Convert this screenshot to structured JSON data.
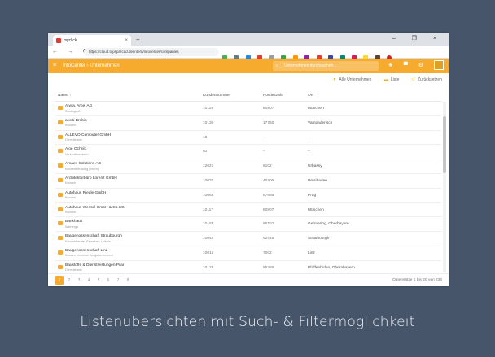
{
  "browser": {
    "tab_title": "myclick",
    "tab_close": "×",
    "new_tab": "+",
    "window_controls": "– ❐ ×",
    "nav": "← → C",
    "url": "https://cloud.topsparcad.de/intern/infocenter/companies"
  },
  "app": {
    "menu_icon": "≡",
    "breadcrumb": "InfoCenter › Unternehmen",
    "search_placeholder": "Unternehmen durchsuchen...",
    "accent_color": "#f6ab2e"
  },
  "actions": {
    "all": "Alle Unternehmen",
    "list": "Liste",
    "reset": "Zurücksetzen"
  },
  "table": {
    "headers": [
      "Name ↑",
      "Kundennummer",
      "Postleitzahl",
      "Ort"
    ],
    "rows": [
      {
        "name": "A.w.a. Arbel AG",
        "sub": "Stadtsgroß",
        "num": "10119",
        "zip": "80807",
        "city": "München"
      },
      {
        "name": "acotti Brebio",
        "sub": "Kunden",
        "num": "10130",
        "zip": "17750",
        "city": "Vampadensch"
      },
      {
        "name": "ALLEVO Computer GmbH",
        "sub": "Dienstleister",
        "num": "18",
        "zip": "–",
        "city": "–"
      },
      {
        "name": "Aloe Ochnik",
        "sub": "Verkaufszentrum",
        "num": "01",
        "zip": "–",
        "city": "–"
      },
      {
        "name": "Amaen Solutions AG",
        "sub": "Kundenberatung (intern)",
        "num": "12021",
        "zip": "8102",
        "city": "Urbassy"
      },
      {
        "name": "Architekturbüro Lorenz GmbH",
        "sub": "Kunden",
        "num": "10034",
        "zip": "40206",
        "city": "Wesibaden"
      },
      {
        "name": "Autohaus Riedle GmbH",
        "sub": "Kunden",
        "num": "10063",
        "zip": "87665",
        "city": "Prag"
      },
      {
        "name": "Autohaus Wessel GmbH & Co.KG",
        "sub": "Kunden",
        "num": "10117",
        "zip": "80807",
        "city": "München"
      },
      {
        "name": "Bankhaus",
        "sub": "Wiehergo",
        "num": "10153",
        "zip": "85110",
        "city": "Germering, Oberbayern"
      },
      {
        "name": "Baugenossenschaft Straubourgh",
        "sub": "Kundenberater Einzelnes Leibnis",
        "num": "10042",
        "zip": "92445",
        "city": "Straubourgh"
      },
      {
        "name": "Baugenossenschaft Linz",
        "sub": "Kunden einzelner Aufgabenbereich",
        "num": "10015",
        "zip": "7002",
        "city": "Linz"
      },
      {
        "name": "Baustoffe & Dienstleistungen Pilar",
        "sub": "Dienstleister",
        "num": "10123",
        "zip": "85286",
        "city": "Pfaffenhofen, Obernbayern"
      },
      {
        "name": "Brückewies",
        "sub": "Kunden",
        "num": "10160",
        "zip": "85110",
        "city": "Germering, Oberbayern"
      }
    ]
  },
  "pagination": {
    "pages": [
      "1",
      "2",
      "3",
      "4",
      "5",
      "6",
      "7",
      "8"
    ],
    "count": "Datensätze 1 bis 20 von 236"
  },
  "caption": "Listenübersichten mit Such- & Filtermöglichkeit"
}
